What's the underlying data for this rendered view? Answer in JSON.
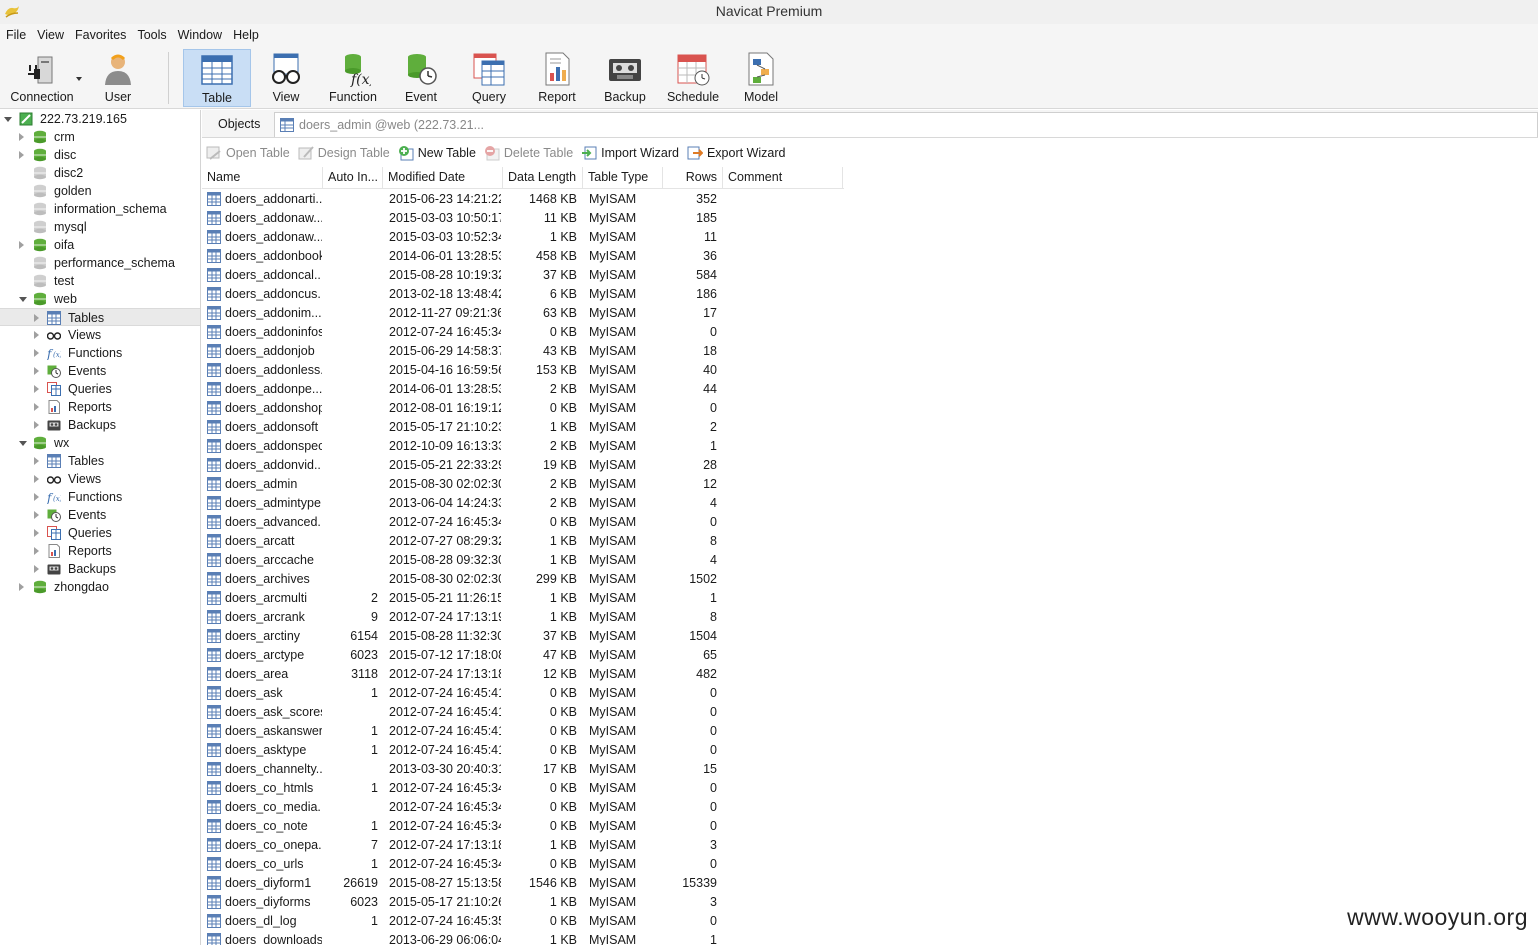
{
  "window": {
    "title": "Navicat Premium"
  },
  "menu": [
    "File",
    "View",
    "Favorites",
    "Tools",
    "Window",
    "Help"
  ],
  "toolbar": {
    "items": [
      {
        "id": "connection",
        "label": "Connection",
        "icon": "plug-icon"
      },
      {
        "id": "user",
        "label": "User",
        "icon": "user-icon"
      },
      {
        "id": "table",
        "label": "Table",
        "icon": "table-icon",
        "active": true
      },
      {
        "id": "view",
        "label": "View",
        "icon": "glasses-icon"
      },
      {
        "id": "function",
        "label": "Function",
        "icon": "function-icon"
      },
      {
        "id": "event",
        "label": "Event",
        "icon": "event-icon"
      },
      {
        "id": "query",
        "label": "Query",
        "icon": "query-icon"
      },
      {
        "id": "report",
        "label": "Report",
        "icon": "report-icon"
      },
      {
        "id": "backup",
        "label": "Backup",
        "icon": "backup-icon"
      },
      {
        "id": "schedule",
        "label": "Schedule",
        "icon": "schedule-icon"
      },
      {
        "id": "model",
        "label": "Model",
        "icon": "model-icon"
      }
    ]
  },
  "tree": {
    "connection": "222.73.219.165",
    "databases": [
      {
        "name": "crm",
        "open": false,
        "active": true
      },
      {
        "name": "disc",
        "open": false,
        "active": true
      },
      {
        "name": "disc2",
        "open": false,
        "active": false
      },
      {
        "name": "golden",
        "open": false,
        "active": false
      },
      {
        "name": "information_schema",
        "open": false,
        "active": false
      },
      {
        "name": "mysql",
        "open": false,
        "active": false
      },
      {
        "name": "oifa",
        "open": false,
        "active": true
      },
      {
        "name": "performance_schema",
        "open": false,
        "active": false
      },
      {
        "name": "test",
        "open": false,
        "active": false
      },
      {
        "name": "web",
        "open": true,
        "active": true
      },
      {
        "name": "wx",
        "open": true,
        "active": true
      },
      {
        "name": "zhongdao",
        "open": false,
        "active": true
      }
    ],
    "children": [
      "Tables",
      "Views",
      "Functions",
      "Events",
      "Queries",
      "Reports",
      "Backups"
    ],
    "selected": "web.Tables"
  },
  "tabs": {
    "objects": "Objects",
    "active_tab": "doers_admin @web (222.73.21..."
  },
  "object_toolbar": {
    "open_table": "Open Table",
    "design_table": "Design Table",
    "new_table": "New Table",
    "delete_table": "Delete Table",
    "import_wizard": "Import Wizard",
    "export_wizard": "Export Wizard"
  },
  "table": {
    "columns": [
      "Name",
      "Auto In...",
      "Modified Date",
      "Data Length",
      "Table Type",
      "Rows",
      "Comment"
    ],
    "rows": [
      [
        "doers_addonarti...",
        "",
        "2015-06-23 14:21:22",
        "1468 KB",
        "MyISAM",
        "352"
      ],
      [
        "doers_addonaw...",
        "",
        "2015-03-03 10:50:17",
        "11 KB",
        "MyISAM",
        "185"
      ],
      [
        "doers_addonaw...",
        "",
        "2015-03-03 10:52:34",
        "1 KB",
        "MyISAM",
        "11"
      ],
      [
        "doers_addonbook",
        "",
        "2014-06-01 13:28:53",
        "458 KB",
        "MyISAM",
        "36"
      ],
      [
        "doers_addoncal...",
        "",
        "2015-08-28 10:19:32",
        "37 KB",
        "MyISAM",
        "584"
      ],
      [
        "doers_addoncus...",
        "",
        "2013-02-18 13:48:42",
        "6 KB",
        "MyISAM",
        "186"
      ],
      [
        "doers_addonim...",
        "",
        "2012-11-27 09:21:36",
        "63 KB",
        "MyISAM",
        "17"
      ],
      [
        "doers_addoninfos",
        "",
        "2012-07-24 16:45:34",
        "0 KB",
        "MyISAM",
        "0"
      ],
      [
        "doers_addonjob",
        "",
        "2015-06-29 14:58:37",
        "43 KB",
        "MyISAM",
        "18"
      ],
      [
        "doers_addonless...",
        "",
        "2015-04-16 16:59:56",
        "153 KB",
        "MyISAM",
        "40"
      ],
      [
        "doers_addonpe...",
        "",
        "2014-06-01 13:28:53",
        "2 KB",
        "MyISAM",
        "44"
      ],
      [
        "doers_addonshop",
        "",
        "2012-08-01 16:19:12",
        "0 KB",
        "MyISAM",
        "0"
      ],
      [
        "doers_addonsoft",
        "",
        "2015-05-17 21:10:23",
        "1 KB",
        "MyISAM",
        "2"
      ],
      [
        "doers_addonspec",
        "",
        "2012-10-09 16:13:33",
        "2 KB",
        "MyISAM",
        "1"
      ],
      [
        "doers_addonvid...",
        "",
        "2015-05-21 22:33:29",
        "19 KB",
        "MyISAM",
        "28"
      ],
      [
        "doers_admin",
        "",
        "2015-08-30 02:02:30",
        "2 KB",
        "MyISAM",
        "12"
      ],
      [
        "doers_admintype",
        "",
        "2013-06-04 14:24:33",
        "2 KB",
        "MyISAM",
        "4"
      ],
      [
        "doers_advanced...",
        "",
        "2012-07-24 16:45:34",
        "0 KB",
        "MyISAM",
        "0"
      ],
      [
        "doers_arcatt",
        "",
        "2012-07-27 08:29:32",
        "1 KB",
        "MyISAM",
        "8"
      ],
      [
        "doers_arccache",
        "",
        "2015-08-28 09:32:30",
        "1 KB",
        "MyISAM",
        "4"
      ],
      [
        "doers_archives",
        "",
        "2015-08-30 02:02:30",
        "299 KB",
        "MyISAM",
        "1502"
      ],
      [
        "doers_arcmulti",
        "2",
        "2015-05-21 11:26:15",
        "1 KB",
        "MyISAM",
        "1"
      ],
      [
        "doers_arcrank",
        "9",
        "2012-07-24 17:13:19",
        "1 KB",
        "MyISAM",
        "8"
      ],
      [
        "doers_arctiny",
        "6154",
        "2015-08-28 11:32:30",
        "37 KB",
        "MyISAM",
        "1504"
      ],
      [
        "doers_arctype",
        "6023",
        "2015-07-12 17:18:08",
        "47 KB",
        "MyISAM",
        "65"
      ],
      [
        "doers_area",
        "3118",
        "2012-07-24 17:13:18",
        "12 KB",
        "MyISAM",
        "482"
      ],
      [
        "doers_ask",
        "1",
        "2012-07-24 16:45:41",
        "0 KB",
        "MyISAM",
        "0"
      ],
      [
        "doers_ask_scores",
        "",
        "2012-07-24 16:45:41",
        "0 KB",
        "MyISAM",
        "0"
      ],
      [
        "doers_askanswer",
        "1",
        "2012-07-24 16:45:41",
        "0 KB",
        "MyISAM",
        "0"
      ],
      [
        "doers_asktype",
        "1",
        "2012-07-24 16:45:41",
        "0 KB",
        "MyISAM",
        "0"
      ],
      [
        "doers_channelty...",
        "",
        "2013-03-30 20:40:31",
        "17 KB",
        "MyISAM",
        "15"
      ],
      [
        "doers_co_htmls",
        "1",
        "2012-07-24 16:45:34",
        "0 KB",
        "MyISAM",
        "0"
      ],
      [
        "doers_co_media...",
        "",
        "2012-07-24 16:45:34",
        "0 KB",
        "MyISAM",
        "0"
      ],
      [
        "doers_co_note",
        "1",
        "2012-07-24 16:45:34",
        "0 KB",
        "MyISAM",
        "0"
      ],
      [
        "doers_co_onepa...",
        "7",
        "2012-07-24 17:13:18",
        "1 KB",
        "MyISAM",
        "3"
      ],
      [
        "doers_co_urls",
        "1",
        "2012-07-24 16:45:34",
        "0 KB",
        "MyISAM",
        "0"
      ],
      [
        "doers_diyform1",
        "26619",
        "2015-08-27 15:13:58",
        "1546 KB",
        "MyISAM",
        "15339"
      ],
      [
        "doers_diyforms",
        "6023",
        "2015-05-17 21:10:26",
        "1 KB",
        "MyISAM",
        "3"
      ],
      [
        "doers_dl_log",
        "1",
        "2012-07-24 16:45:35",
        "0 KB",
        "MyISAM",
        "0"
      ],
      [
        "doers_downloads",
        "",
        "2013-06-29 06:06:04",
        "1 KB",
        "MyISAM",
        "1"
      ]
    ]
  },
  "watermark": "www.wooyun.org"
}
